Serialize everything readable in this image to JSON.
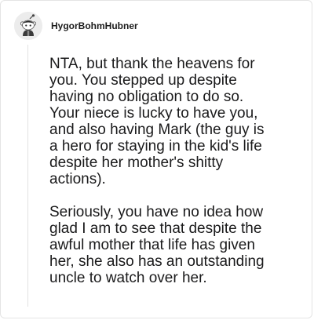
{
  "comment": {
    "username": "HygorBohmHubner",
    "avatar_icon": "snoo-avatar-icon",
    "paragraphs": [
      "NTA, but thank the heavens for\nyou. You stepped up despite\nhaving no obligation to do so.\nYour niece is lucky to have you,\nand also having Mark (the guy is\na hero for staying in the kid's life\ndespite her mother's shitty\nactions).",
      "Seriously, you have no idea how\nglad I am to see that despite the\nawful mother that life has given\nher, she also has an outstanding\nuncle to watch over her."
    ]
  }
}
